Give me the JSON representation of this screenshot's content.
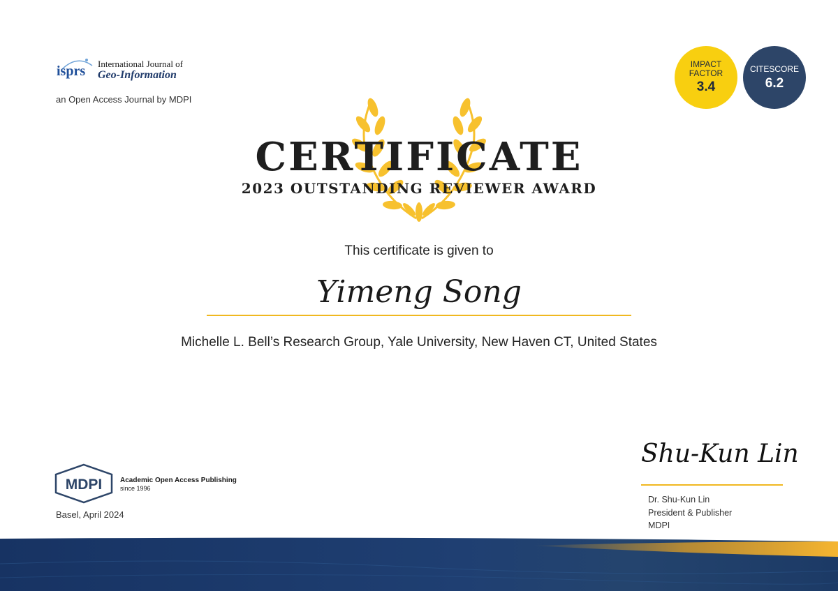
{
  "journal": {
    "logo_text": "isprs",
    "name_line1": "International Journal of",
    "name_line2": "Geo-Information",
    "subtitle": "an Open Access Journal by MDPI"
  },
  "metrics": {
    "impact_factor": {
      "label_line1": "IMPACT",
      "label_line2": "FACTOR",
      "value": "3.4",
      "color": "#f8cf10"
    },
    "citescore": {
      "label": "CITESCORE",
      "value": "6.2",
      "color": "#2d4568"
    }
  },
  "certificate": {
    "title": "CERTIFICATE",
    "subtitle": "2023 OUTSTANDING REVIEWER AWARD",
    "given_to_text": "This certificate is given to",
    "recipient": "Yimeng Song",
    "affiliation": "Michelle L. Bell’s Research Group, Yale University, New Haven CT, United States"
  },
  "publisher": {
    "logo_text": "MDPI",
    "tagline": "Academic Open Access Publishing",
    "since": "since 1996",
    "place_date": "Basel, April 2024"
  },
  "signatory": {
    "signature": "Shu-Kun Lin",
    "name": "Dr. Shu-Kun Lin",
    "title": "President & Publisher",
    "organization": "MDPI"
  },
  "colors": {
    "accent_gold": "#f0b820",
    "laurel": "#f7c12e",
    "banner_blue": "#1f3a6a",
    "banner_orange": "#f3a81e"
  }
}
